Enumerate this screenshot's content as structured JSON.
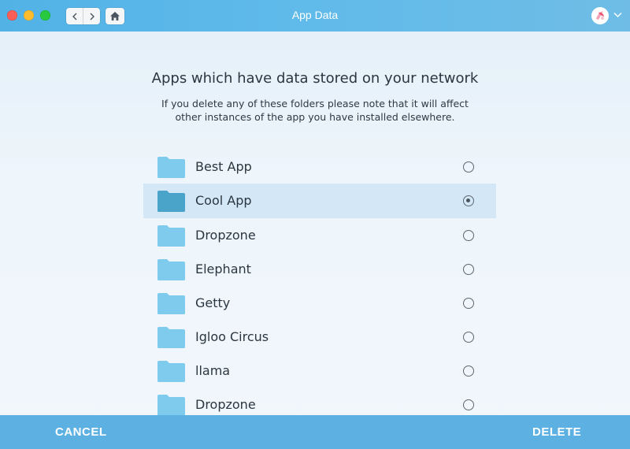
{
  "window": {
    "title": "App Data"
  },
  "toolbar": {
    "back_icon": "chevron-left-icon",
    "forward_icon": "chevron-right-icon",
    "home_icon": "home-icon"
  },
  "main": {
    "heading": "Apps which have data stored on your network",
    "subheading": "If you delete any of these folders please note that it will affect other instances of the app you have installed elsewhere.",
    "items": [
      {
        "label": "Best App",
        "selected": false
      },
      {
        "label": "Cool App",
        "selected": true
      },
      {
        "label": "Dropzone",
        "selected": false
      },
      {
        "label": "Elephant",
        "selected": false
      },
      {
        "label": "Getty",
        "selected": false
      },
      {
        "label": "Igloo Circus",
        "selected": false
      },
      {
        "label": "llama",
        "selected": false
      },
      {
        "label": "Dropzone",
        "selected": false
      }
    ]
  },
  "footer": {
    "cancel_label": "CANCEL",
    "delete_label": "DELETE"
  },
  "colors": {
    "accent": "#5cb1e2",
    "folder": "#7fcbee",
    "folder_selected": "#4aa3c9",
    "selected_row": "#d3e7f7"
  }
}
